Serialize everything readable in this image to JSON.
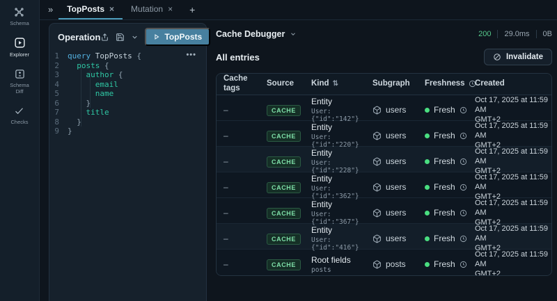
{
  "sidebar": {
    "items": [
      {
        "label": "Schema",
        "icon": "schema-graph-icon",
        "active": false
      },
      {
        "label": "Explorer",
        "icon": "explorer-play-icon",
        "active": true
      },
      {
        "label": "Schema Diff",
        "icon": "schema-diff-icon",
        "active": false
      },
      {
        "label": "Checks",
        "icon": "checks-icon",
        "active": false
      }
    ]
  },
  "tabbar": {
    "collapse_icon": "»",
    "tabs": [
      {
        "label": "TopPosts",
        "close_icon": "×",
        "active": true
      },
      {
        "label": "Mutation",
        "close_icon": "×",
        "active": false
      }
    ],
    "new_tab_icon": "+"
  },
  "operation": {
    "title": "Operation",
    "run_button_label": "TopPosts",
    "menu_icon": "•••",
    "code": {
      "lines": [
        {
          "num": "1",
          "kw": "query ",
          "name": "TopPosts ",
          "brace": "{"
        },
        {
          "num": "2",
          "field": "  posts ",
          "brace": "{"
        },
        {
          "num": "3",
          "field": "    author ",
          "brace": "{"
        },
        {
          "num": "4",
          "field": "      email"
        },
        {
          "num": "5",
          "field": "      name"
        },
        {
          "num": "6",
          "brace": "    }"
        },
        {
          "num": "7",
          "field": "    title"
        },
        {
          "num": "8",
          "brace": "  }"
        },
        {
          "num": "9",
          "brace": "}"
        }
      ]
    }
  },
  "panel": {
    "title": "Cache Debugger",
    "stats": {
      "status_code": "200",
      "duration": "29.0ms",
      "response_size": "0B"
    },
    "entries_heading": "All entries",
    "invalidate_label": "Invalidate"
  },
  "table": {
    "columns": [
      "Cache tags",
      "Source",
      "Kind",
      "Subgraph",
      "Freshness",
      "Created"
    ],
    "kind_sort_icon": "⇅",
    "rows": [
      {
        "cache_tags": "–",
        "source": "CACHE",
        "kind": "Entity",
        "kind_detail": "User:{\"id\":\"142\"}",
        "subgraph": "users",
        "freshness": "Fresh",
        "created_line1": "Oct 17, 2025 at 11:59 AM",
        "created_line2": "GMT+2"
      },
      {
        "cache_tags": "–",
        "source": "CACHE",
        "kind": "Entity",
        "kind_detail": "User:{\"id\":\"220\"}",
        "subgraph": "users",
        "freshness": "Fresh",
        "created_line1": "Oct 17, 2025 at 11:59 AM",
        "created_line2": "GMT+2"
      },
      {
        "cache_tags": "–",
        "source": "CACHE",
        "kind": "Entity",
        "kind_detail": "User:{\"id\":\"228\"}",
        "subgraph": "users",
        "freshness": "Fresh",
        "created_line1": "Oct 17, 2025 at 11:59 AM",
        "created_line2": "GMT+2"
      },
      {
        "cache_tags": "–",
        "source": "CACHE",
        "kind": "Entity",
        "kind_detail": "User:{\"id\":\"362\"}",
        "subgraph": "users",
        "freshness": "Fresh",
        "created_line1": "Oct 17, 2025 at 11:59 AM",
        "created_line2": "GMT+2"
      },
      {
        "cache_tags": "–",
        "source": "CACHE",
        "kind": "Entity",
        "kind_detail": "User:{\"id\":\"367\"}",
        "subgraph": "users",
        "freshness": "Fresh",
        "created_line1": "Oct 17, 2025 at 11:59 AM",
        "created_line2": "GMT+2"
      },
      {
        "cache_tags": "–",
        "source": "CACHE",
        "kind": "Entity",
        "kind_detail": "User:{\"id\":\"416\"}",
        "subgraph": "users",
        "freshness": "Fresh",
        "created_line1": "Oct 17, 2025 at 11:59 AM",
        "created_line2": "GMT+2"
      },
      {
        "cache_tags": "–",
        "source": "CACHE",
        "kind": "Root fields",
        "kind_detail": "posts",
        "subgraph": "posts",
        "freshness": "Fresh",
        "created_line1": "Oct 17, 2025 at 11:59 AM",
        "created_line2": "GMT+2"
      }
    ]
  },
  "colors": {
    "accent_teal": "#4d9cba",
    "run_button_blue": "#47809f",
    "success_green": "#4ade80",
    "badge_green": "#7ee0a8",
    "keyword_blue": "#53b1e0",
    "field_teal": "#2fc7a4"
  }
}
